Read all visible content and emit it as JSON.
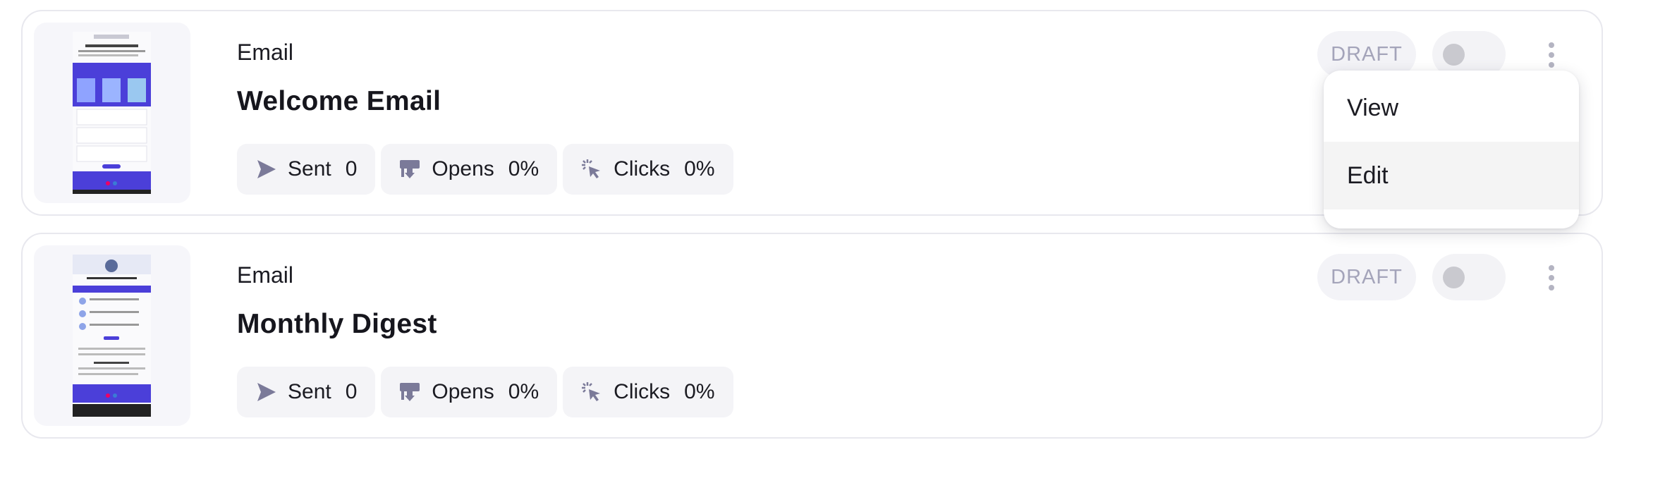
{
  "campaigns": [
    {
      "type": "Email",
      "title": "Welcome Email",
      "status": "DRAFT",
      "enabled": false,
      "stats": {
        "sent_label": "Sent",
        "sent_value": "0",
        "opens_label": "Opens",
        "opens_value": "0%",
        "clicks_label": "Clicks",
        "clicks_value": "0%"
      }
    },
    {
      "type": "Email",
      "title": "Monthly Digest",
      "status": "DRAFT",
      "enabled": false,
      "stats": {
        "sent_label": "Sent",
        "sent_value": "0",
        "opens_label": "Opens",
        "opens_value": "0%",
        "clicks_label": "Clicks",
        "clicks_value": "0%"
      }
    }
  ],
  "menu": {
    "items": [
      {
        "label": "View"
      },
      {
        "label": "Edit"
      }
    ]
  },
  "colors": {
    "accent": "#4338ca",
    "icon": "#7b7a99",
    "card_border": "#e8e8ee",
    "badge_text": "#a4a4ba"
  },
  "icons": {
    "sent": "send-icon",
    "opens": "open-mail-icon",
    "clicks": "click-cursor-icon",
    "more": "more-vertical-icon"
  }
}
